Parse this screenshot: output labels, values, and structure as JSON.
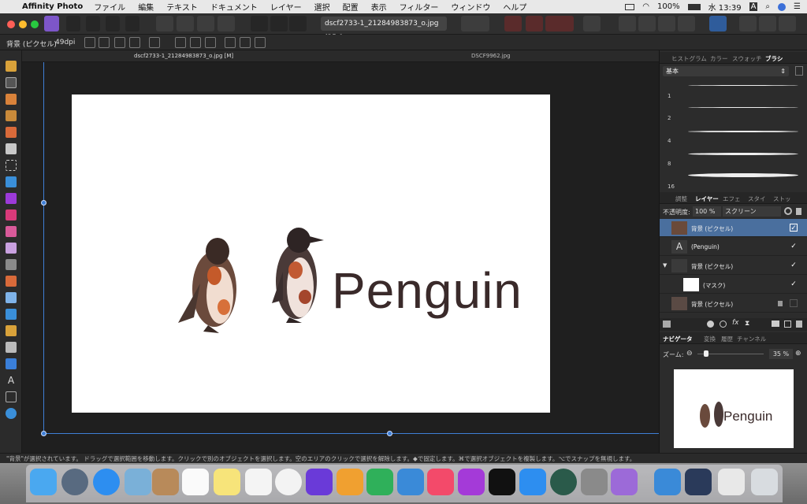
{
  "menubar": {
    "app_name": "Affinity Photo",
    "items": [
      "ファイル",
      "編集",
      "テキスト",
      "ドキュメント",
      "レイヤー",
      "選択",
      "配置",
      "表示",
      "フィルター",
      "ウィンドウ",
      "ヘルプ"
    ],
    "battery": "100%",
    "clock": "水 13:39"
  },
  "toolbar": {
    "document_select": "dscf2733-1_21284983873_o.jpg (35.0"
  },
  "context": {
    "layer_type": "背景 (ピクセル)",
    "dpi": "49dpi"
  },
  "doc_tabs": [
    "dscf2733-1_21284983873_o.jpg [M]",
    "DSCF9962.jpg"
  ],
  "canvas": {
    "text": "Penguin"
  },
  "brush_panel": {
    "tabs": [
      "ヒストグラム",
      "カラー",
      "スウォッチ",
      "ブラシ"
    ],
    "category": "基本",
    "sizes": [
      "1",
      "2",
      "4",
      "8",
      "16"
    ]
  },
  "layers_panel": {
    "tabs": [
      "調整",
      "レイヤー",
      "エフェ",
      "スタイ",
      "ストッ"
    ],
    "opacity_label": "不透明度:",
    "opacity_value": "100 %",
    "blend_mode": "スクリーン",
    "rows": [
      {
        "name": "背景 (ピクセル)",
        "checked": "✓"
      },
      {
        "name": "(Penguin)",
        "checked": "✓"
      },
      {
        "name": "背景 (ピクセル)",
        "checked": "✓"
      },
      {
        "name": "(マスク)",
        "checked": "✓"
      },
      {
        "name": "背景 (ピクセル)",
        "checked": ""
      }
    ]
  },
  "navigator_panel": {
    "tabs": [
      "ナビゲータ",
      "変換",
      "履歴",
      "チャンネル"
    ],
    "zoom_label": "ズーム:",
    "zoom_value": "35 %",
    "preview_text": "Penguin"
  },
  "status": {
    "message": "\"背景\"が選択されています。 ドラッグで選択範囲を移動します。クリックで別のオブジェクトを選択します。空のエリアのクリックで選択を解除します。◆で固定します。⌘で選択オブジェクトを複製します。⌥でスナップを無視します。"
  },
  "colors": {
    "accent": "#3f7fd6",
    "selected_layer": "#4a6f9e"
  }
}
